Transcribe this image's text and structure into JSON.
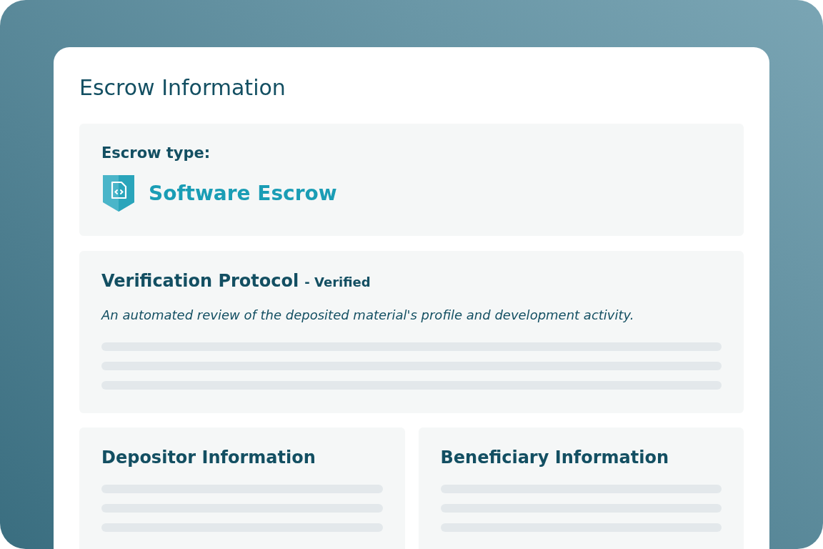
{
  "card": {
    "title": "Escrow Information"
  },
  "escrow_type": {
    "label": "Escrow type:",
    "value": "Software Escrow"
  },
  "verification": {
    "title": "Verification Protocol",
    "status": "- Verified",
    "description": "An automated review of the deposited material's profile and development activity."
  },
  "parties": [
    {
      "title": "Depositor Information"
    },
    {
      "title": "Beneficiary Information"
    }
  ]
}
